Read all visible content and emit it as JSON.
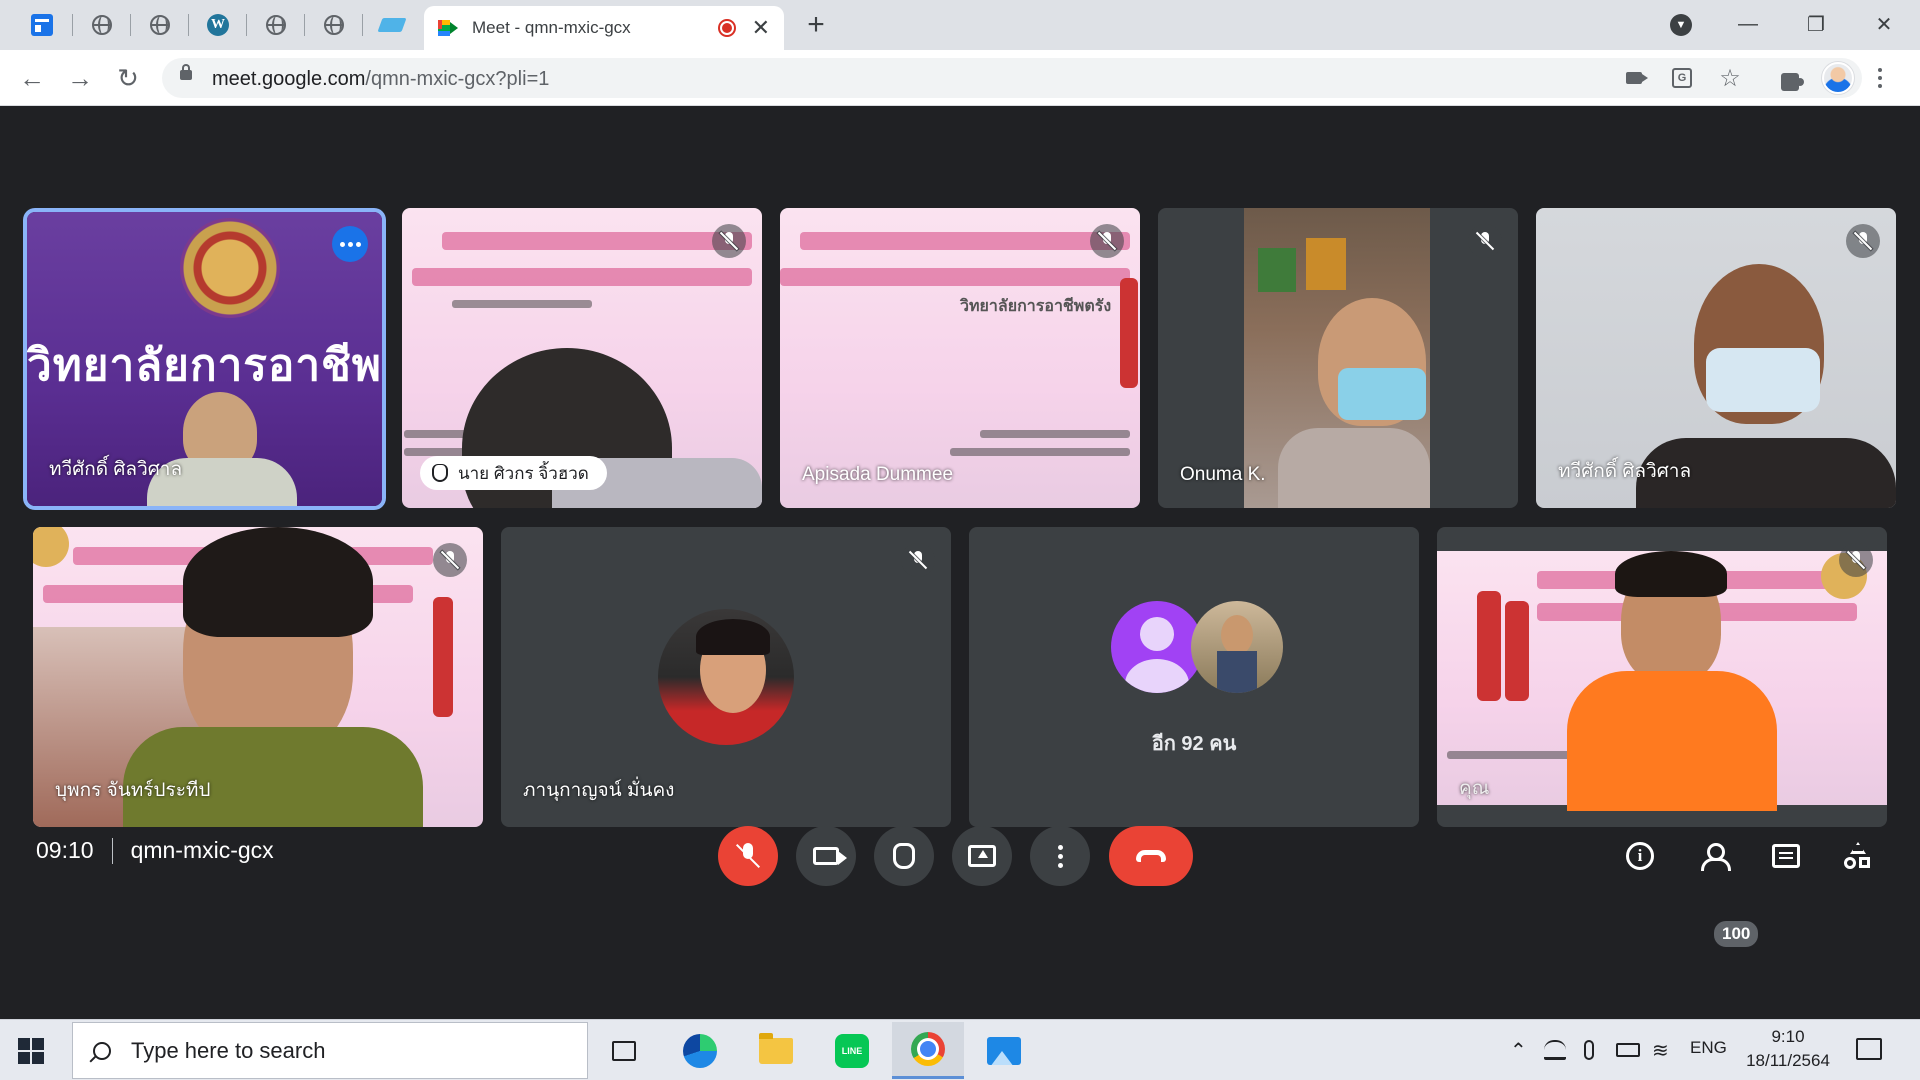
{
  "browser": {
    "active_tab_title": "Meet - qmn-mxic-gcx",
    "url_host": "meet.google.com",
    "url_path": "/qmn-mxic-gcx?pli=1",
    "new_tab_symbol": "+",
    "close_symbol": "✕"
  },
  "tiles": [
    {
      "name": "ทวีศักดิ์ ศิลวิศาล",
      "banner": "วิทยาลัยการอาชีพ"
    },
    {
      "name": "นาย ศิวกร จิ้วฮวด"
    },
    {
      "name": "Apisada Dummee",
      "banner_line": "วิทยาลัยการอาชีพตรัง"
    },
    {
      "name": "Onuma K."
    },
    {
      "name": "ทวีศักดิ์ ศิลวิศาล"
    },
    {
      "name": "บุพกร จันทร์ประทีป"
    },
    {
      "name": "ภานุกาญจน์ มั่นคง"
    },
    {
      "more_label": "อีก 92 คน"
    },
    {
      "name": "คุณ"
    }
  ],
  "meeting": {
    "time": "09:10",
    "code": "qmn-mxic-gcx",
    "participant_count": "100"
  },
  "taskbar": {
    "search_placeholder": "Type here to search",
    "line_label": "LINE",
    "lang": "ENG",
    "time": "9:10",
    "date": "18/11/2564"
  },
  "colors": {
    "meet_bg": "#202124",
    "end_call": "#ea4335",
    "active_speaker": "#8ab4f8"
  }
}
